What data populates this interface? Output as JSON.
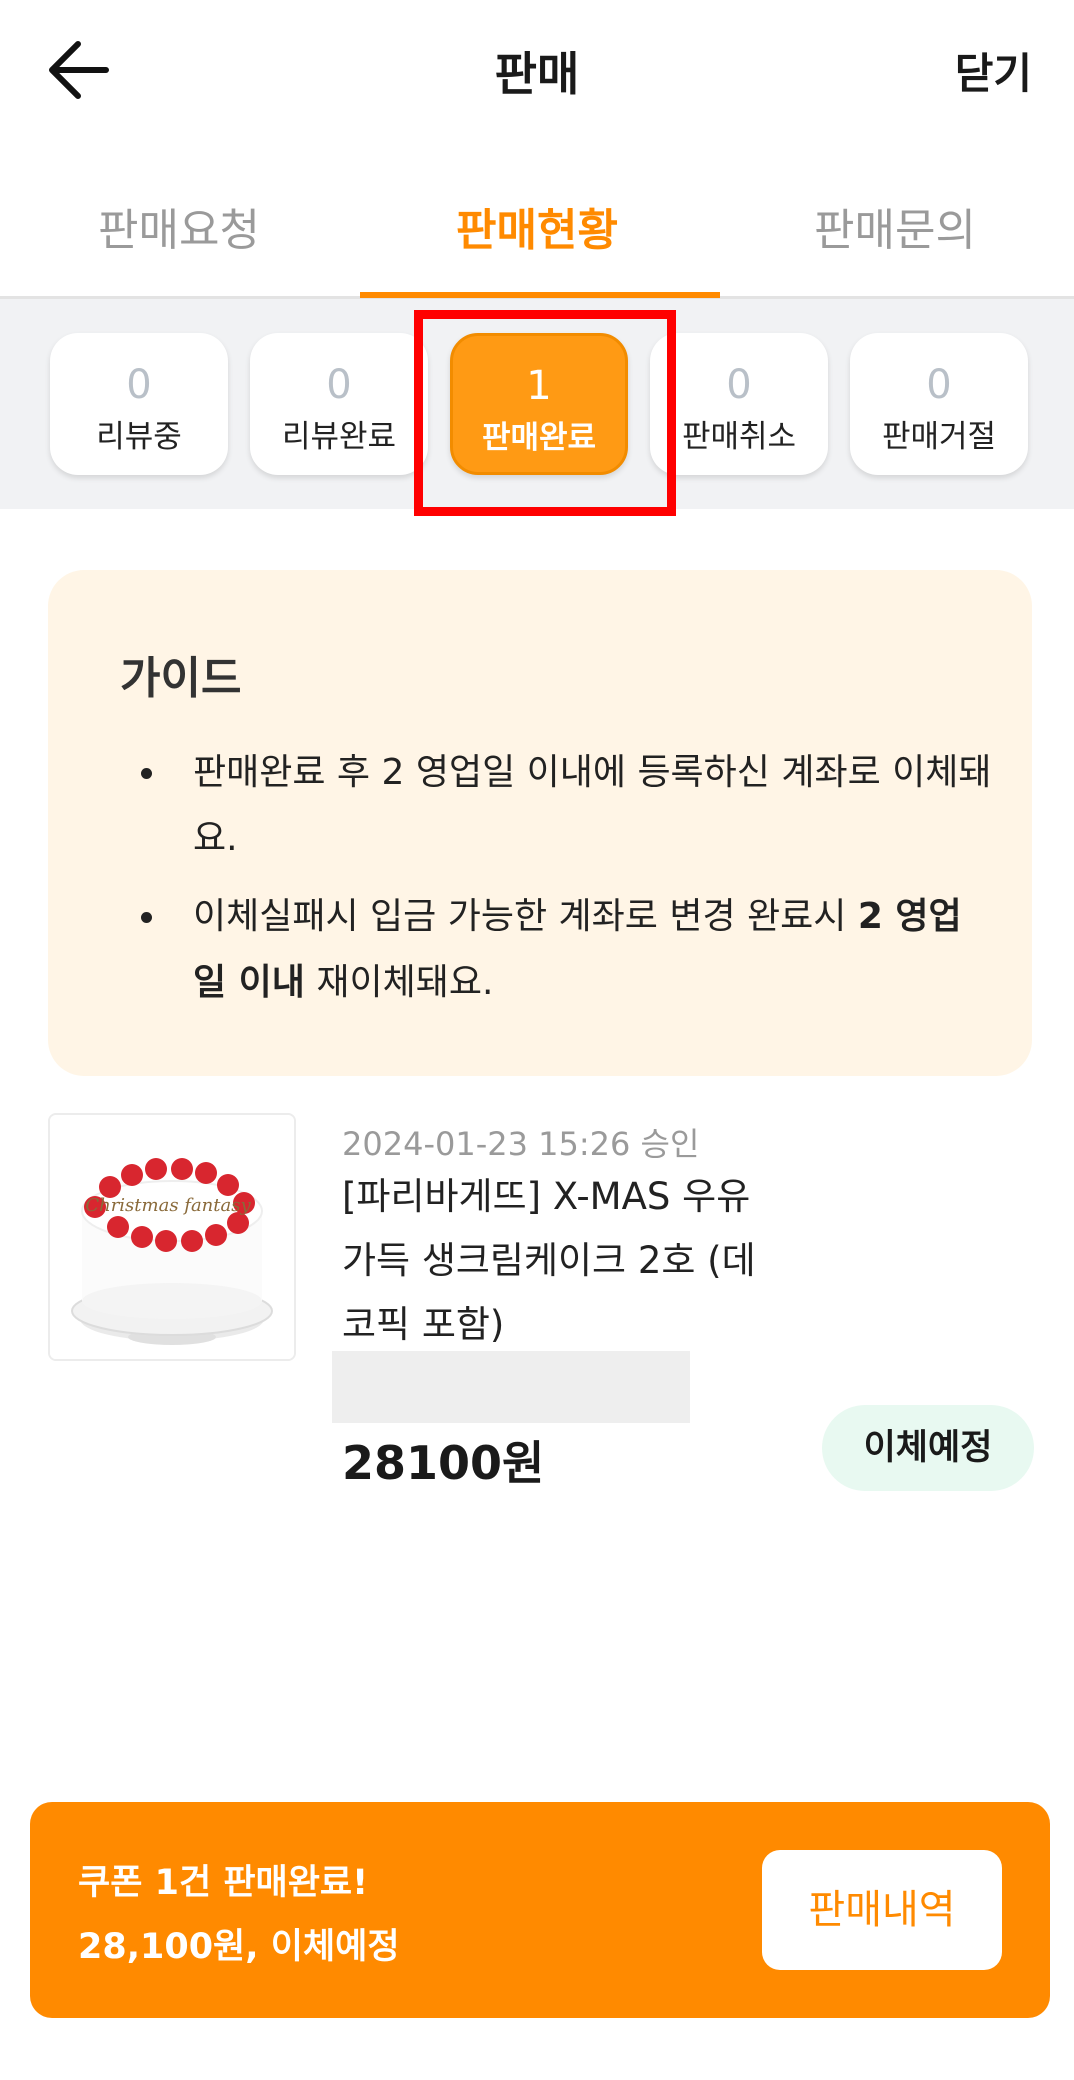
{
  "header": {
    "title": "판매",
    "close_label": "닫기",
    "back_icon": "arrow-left-icon"
  },
  "tabs": [
    {
      "label": "판매요청",
      "active": false
    },
    {
      "label": "판매현황",
      "active": true
    },
    {
      "label": "판매문의",
      "active": false
    }
  ],
  "status_filters": [
    {
      "count": "0",
      "label": "리뷰중",
      "active": false
    },
    {
      "count": "0",
      "label": "리뷰완료",
      "active": false
    },
    {
      "count": "1",
      "label": "판매완료",
      "active": true
    },
    {
      "count": "0",
      "label": "판매취소",
      "active": false
    },
    {
      "count": "0",
      "label": "판매거절",
      "active": false
    }
  ],
  "guide": {
    "title": "가이드",
    "item1": "판매완료 후 2 영업일 이내에 등록하신 계좌로 이체돼요.",
    "item2_pre": "이체실패시 입금 가능한 계좌로 변경 완료시 ",
    "item2_bold": "2 영업일 이내",
    "item2_post": " 재이체돼요."
  },
  "product": {
    "date": "2024-01-23 15:26 승인",
    "name": "[파리바게뜨] X-MAS 우유가득 생크림케이크 2호 (데코픽 포함)",
    "price": "28100원",
    "status": "이체예정",
    "cake_topper_text": "Christmas fantasy"
  },
  "bottom_banner": {
    "line1": "쿠폰 1건 판매완료!",
    "line2": "28,100원, 이체예정",
    "button_label": "판매내역"
  },
  "colors": {
    "accent": "#ff8a00",
    "highlight": "#ff0000",
    "badge_bg": "#e8f9f1"
  }
}
